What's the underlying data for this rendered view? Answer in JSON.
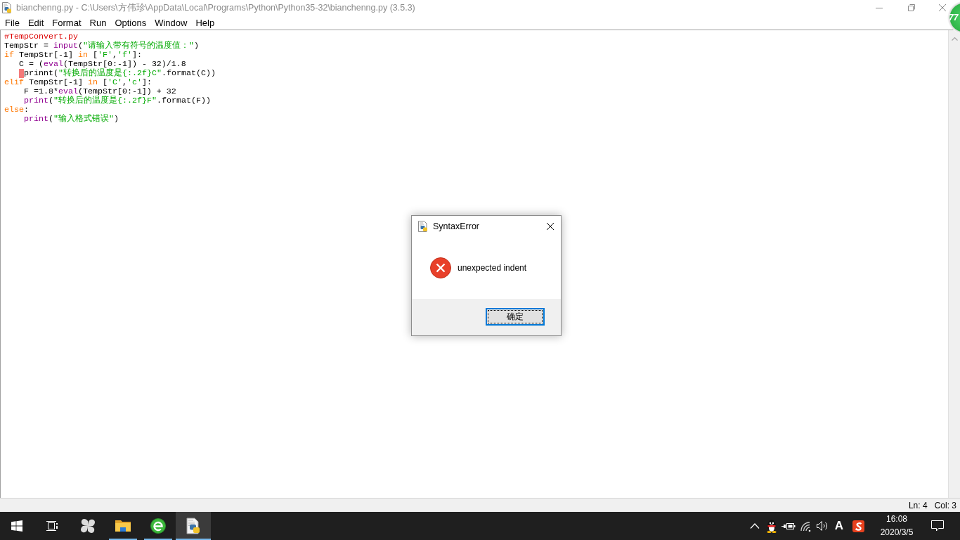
{
  "window": {
    "title": "bianchenng.py - C:\\Users\\方伟珍\\AppData\\Local\\Programs\\Python\\Python35-32\\bianchenng.py (3.5.3)",
    "active": false
  },
  "menu": [
    "File",
    "Edit",
    "Format",
    "Run",
    "Options",
    "Window",
    "Help"
  ],
  "editor": {
    "lines": [
      {
        "error": false,
        "tokens": [
          {
            "text": "#TempConvert.py",
            "kind": "comment"
          }
        ]
      },
      {
        "error": false,
        "tokens": [
          {
            "text": "TempStr = ",
            "kind": "plain"
          },
          {
            "text": "input",
            "kind": "builtin"
          },
          {
            "text": "(",
            "kind": "plain"
          },
          {
            "text": "\"请输入带有符号的温度值：\"",
            "kind": "string"
          },
          {
            "text": ")",
            "kind": "plain"
          }
        ]
      },
      {
        "error": false,
        "tokens": [
          {
            "text": "if",
            "kind": "keyword"
          },
          {
            "text": " TempStr[-1] ",
            "kind": "plain"
          },
          {
            "text": "in",
            "kind": "keyword"
          },
          {
            "text": " [",
            "kind": "plain"
          },
          {
            "text": "'F'",
            "kind": "string"
          },
          {
            "text": ",",
            "kind": "plain"
          },
          {
            "text": "'f'",
            "kind": "string"
          },
          {
            "text": "]:",
            "kind": "plain"
          }
        ]
      },
      {
        "error": false,
        "tokens": [
          {
            "text": "   C = (",
            "kind": "plain"
          },
          {
            "text": "eval",
            "kind": "builtin"
          },
          {
            "text": "(TempStr[0:-1]) - 32)/1.8",
            "kind": "plain"
          }
        ]
      },
      {
        "error": true,
        "tokens": [
          {
            "text": "    prinnt(",
            "kind": "plain"
          },
          {
            "text": "\"转换后的温度是{:.2f}C\"",
            "kind": "string"
          },
          {
            "text": ".format(C))",
            "kind": "plain"
          }
        ]
      },
      {
        "error": false,
        "tokens": [
          {
            "text": "elif",
            "kind": "keyword"
          },
          {
            "text": " TempStr[-1] ",
            "kind": "plain"
          },
          {
            "text": "in",
            "kind": "keyword"
          },
          {
            "text": " [",
            "kind": "plain"
          },
          {
            "text": "'C'",
            "kind": "string"
          },
          {
            "text": ",",
            "kind": "plain"
          },
          {
            "text": "'c'",
            "kind": "string"
          },
          {
            "text": "]:",
            "kind": "plain"
          }
        ]
      },
      {
        "error": false,
        "tokens": [
          {
            "text": "    F =1.8*",
            "kind": "plain"
          },
          {
            "text": "eval",
            "kind": "builtin"
          },
          {
            "text": "(TempStr[0:-1]) + 32",
            "kind": "plain"
          }
        ]
      },
      {
        "error": false,
        "tokens": [
          {
            "text": "    print",
            "kind": "builtin"
          },
          {
            "text": "(",
            "kind": "plain"
          },
          {
            "text": "\"转换后的温度是{:.2f}F\"",
            "kind": "string"
          },
          {
            "text": ".format(F))",
            "kind": "plain"
          }
        ]
      },
      {
        "error": false,
        "tokens": [
          {
            "text": "else",
            "kind": "keyword"
          },
          {
            "text": ":",
            "kind": "plain"
          }
        ]
      },
      {
        "error": false,
        "tokens": [
          {
            "text": "    print",
            "kind": "builtin"
          },
          {
            "text": "(",
            "kind": "plain"
          },
          {
            "text": "\"输入格式错误\"",
            "kind": "string"
          },
          {
            "text": ")",
            "kind": "plain"
          }
        ]
      }
    ]
  },
  "status_bar": {
    "line": "Ln: 4",
    "column": "Col: 3"
  },
  "dialog": {
    "title": "SyntaxError",
    "message": "unexpected indent",
    "buttons": [
      {
        "label": "确定",
        "focused": true
      }
    ]
  },
  "floating_ball": {
    "text": "77"
  },
  "taskbar": {
    "apps": [
      {
        "kind": "fan",
        "running": false,
        "selected": false
      },
      {
        "kind": "folder",
        "running": true,
        "selected": false
      },
      {
        "kind": "browser",
        "running": true,
        "selected": false
      },
      {
        "kind": "python",
        "running": true,
        "selected": true
      }
    ],
    "tray": [
      {
        "kind": "chevron"
      },
      {
        "kind": "penguin"
      },
      {
        "kind": "power"
      },
      {
        "kind": "wifi"
      },
      {
        "kind": "volume"
      },
      {
        "kind": "text",
        "text": "A"
      },
      {
        "kind": "sogou"
      }
    ],
    "clock": {
      "time": "16:08",
      "date": "2020/3/5"
    }
  }
}
